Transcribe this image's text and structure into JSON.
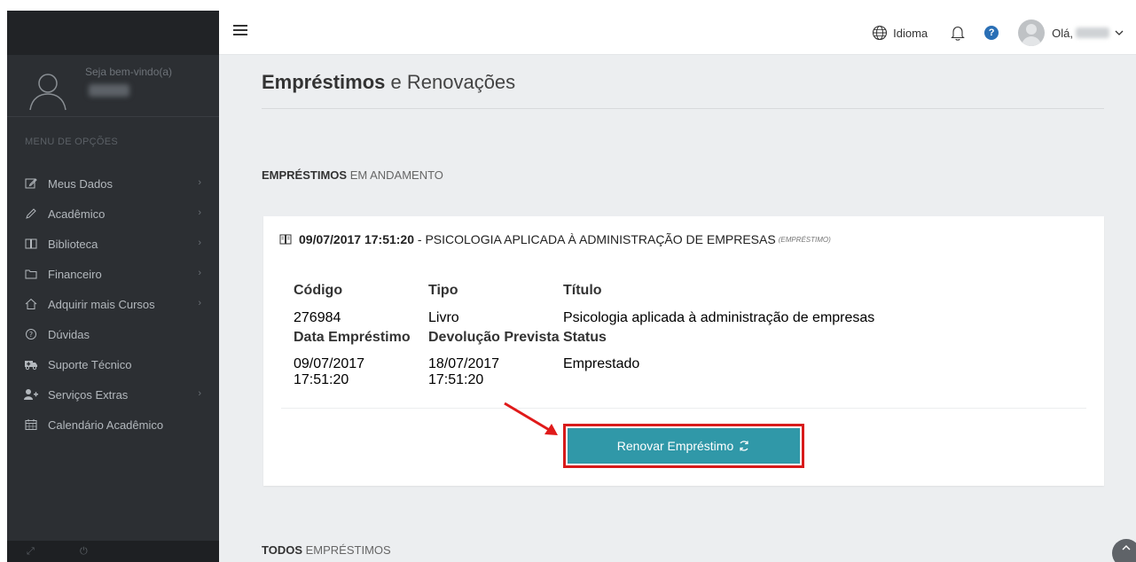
{
  "sidebar": {
    "welcome": "Seja bem-vindo(a)",
    "menu_header": "MENU DE OPÇÕES",
    "items": [
      {
        "label": "Meus Dados",
        "icon": "edit-icon",
        "has_submenu": true
      },
      {
        "label": "Acadêmico",
        "icon": "pencil-icon",
        "has_submenu": true
      },
      {
        "label": "Biblioteca",
        "icon": "book-icon",
        "has_submenu": true
      },
      {
        "label": "Financeiro",
        "icon": "folder-icon",
        "has_submenu": true
      },
      {
        "label": "Adquirir mais Cursos",
        "icon": "home-icon",
        "has_submenu": true
      },
      {
        "label": "Dúvidas",
        "icon": "question-circle-icon",
        "has_submenu": false
      },
      {
        "label": "Suporte Técnico",
        "icon": "ambulance-icon",
        "has_submenu": false
      },
      {
        "label": "Serviços Extras",
        "icon": "user-plus-icon",
        "has_submenu": true
      },
      {
        "label": "Calendário Acadêmico",
        "icon": "calendar-icon",
        "has_submenu": false
      }
    ]
  },
  "topbar": {
    "language_label": "Idioma",
    "greeting": "Olá,"
  },
  "main": {
    "title_bold": "Empréstimos",
    "title_rest": "e Renovações",
    "section_active_bold": "EMPRÉSTIMOS",
    "section_active_rest": "EM ANDAMENTO",
    "section_all_bold": "TODOS",
    "section_all_rest": "EMPRÉSTIMOS",
    "loan": {
      "datetime": "09/07/2017 17:51:20",
      "separator": "-",
      "book_title_upper": "PSICOLOGIA APLICADA À ADMINISTRAÇÃO DE EMPRESAS",
      "type_tag": "(EMPRÉSTIMO)",
      "labels": {
        "codigo": "Código",
        "tipo": "Tipo",
        "titulo": "Título",
        "data_emprestimo": "Data Empréstimo",
        "devolucao_prevista": "Devolução Prevista",
        "status": "Status"
      },
      "values": {
        "codigo": "276984",
        "tipo": "Livro",
        "titulo": "Psicologia aplicada à administração de empresas",
        "data_emprestimo_date": "09/07/2017",
        "data_emprestimo_time": "17:51:20",
        "devolucao_date": "18/07/2017",
        "devolucao_time": "17:51:20",
        "status": "Emprestado"
      },
      "renew_button": "Renovar Empréstimo"
    }
  },
  "colors": {
    "sidebar_bg": "#2c2f33",
    "main_bg": "#eceef0",
    "button_bg": "#3098a8",
    "highlight_red": "#d81b1b",
    "help_blue": "#2a6fb5"
  }
}
